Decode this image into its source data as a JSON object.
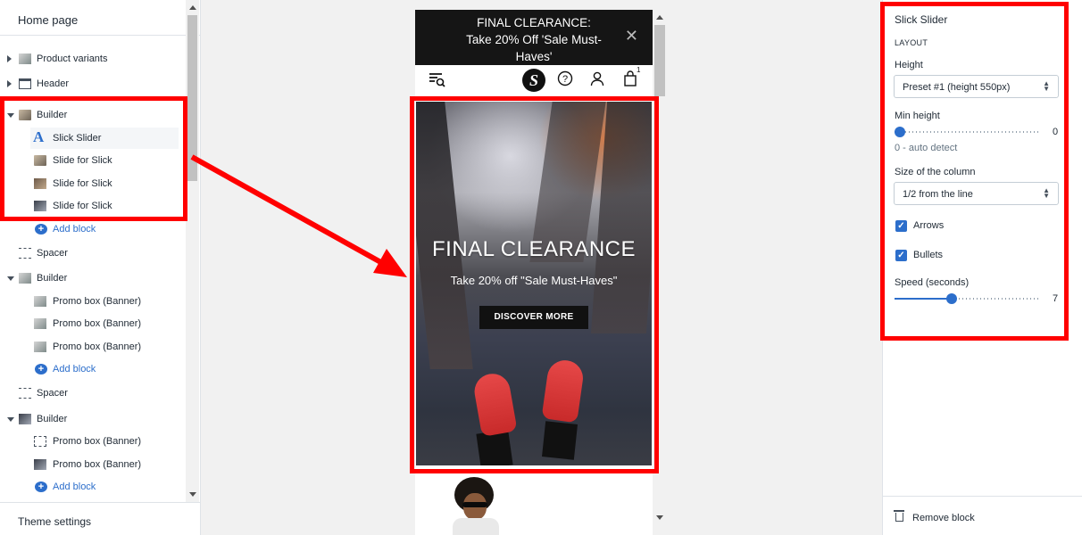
{
  "left": {
    "title": "Home page",
    "tree": [
      {
        "label": "Product variants"
      },
      {
        "label": "Header"
      },
      {
        "label": "Builder"
      },
      {
        "label": "Slick Slider"
      },
      {
        "label": "Slide for Slick"
      },
      {
        "label": "Slide for Slick"
      },
      {
        "label": "Slide for Slick"
      },
      {
        "label": "Add block"
      },
      {
        "label": "Spacer"
      },
      {
        "label": "Builder"
      },
      {
        "label": "Promo box (Banner)"
      },
      {
        "label": "Promo box (Banner)"
      },
      {
        "label": "Promo box (Banner)"
      },
      {
        "label": "Add block"
      },
      {
        "label": "Spacer"
      },
      {
        "label": "Builder"
      },
      {
        "label": "Promo box (Banner)"
      },
      {
        "label": "Promo box (Banner)"
      },
      {
        "label": "Add block"
      }
    ],
    "footer": "Theme settings"
  },
  "preview": {
    "announcement_line1": "FINAL CLEARANCE:",
    "announcement_line2": "Take 20% Off 'Sale Must-",
    "announcement_line3": "Haves'",
    "close_glyph": "✕",
    "cart_count": "1",
    "logo_letter": "S",
    "hero_title": "FINAL CLEARANCE",
    "hero_subtitle": "Take 20% off \"Sale Must-Haves\"",
    "hero_button": "DISCOVER MORE"
  },
  "right": {
    "title": "Slick Slider",
    "section": "LAYOUT",
    "height_label": "Height",
    "height_value": "Preset #1 (height 550px)",
    "min_height_label": "Min height",
    "min_height_value": "0",
    "min_height_min": 0,
    "min_height_help": "0 - auto detect",
    "column_label": "Size of the column",
    "column_value": "1/2 from the line",
    "arrows_label": "Arrows",
    "arrows_checked": true,
    "bullets_label": "Bullets",
    "bullets_checked": true,
    "speed_label": "Speed (seconds)",
    "speed_value": "7",
    "remove_label": "Remove block"
  },
  "colors": {
    "accent": "#2c6ecb",
    "annotation": "#ff0000",
    "announcement_bg": "#151515"
  }
}
